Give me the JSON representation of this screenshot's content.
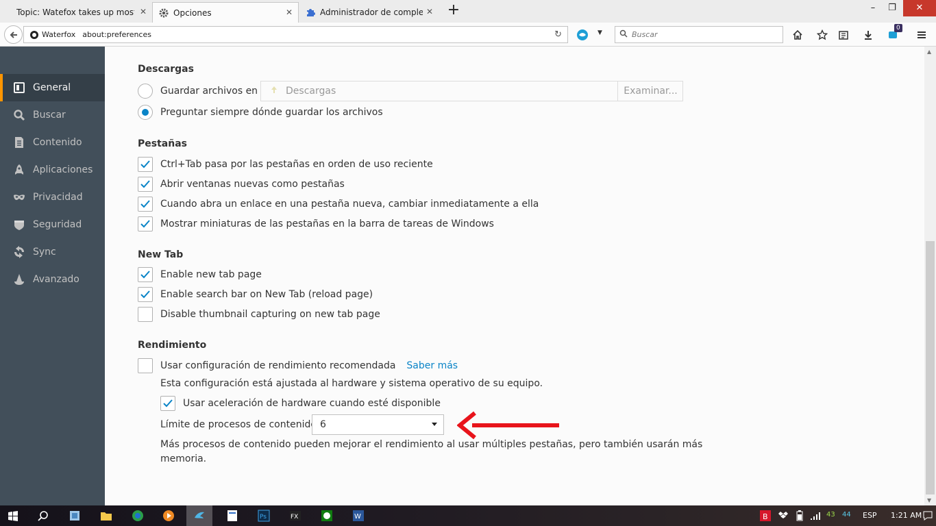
{
  "tabs": [
    {
      "title": "Topic: Watefox takes up most of",
      "icon": "page-icon",
      "state": "inactive"
    },
    {
      "title": "Opciones",
      "icon": "gear-icon",
      "state": "active"
    },
    {
      "title": "Administrador de compleme",
      "icon": "puzzle-icon",
      "state": "inactive"
    }
  ],
  "window_controls": {
    "minimize": "–",
    "restore": "❐",
    "close": "✕"
  },
  "navbar": {
    "identity_label": "Waterfox",
    "url": "about:preferences",
    "search_placeholder": "Buscar",
    "notification_count": "0"
  },
  "sidebar": {
    "items": [
      {
        "label": "General",
        "icon": "general-icon",
        "selected": true
      },
      {
        "label": "Buscar",
        "icon": "search-icon",
        "selected": false
      },
      {
        "label": "Contenido",
        "icon": "content-icon",
        "selected": false
      },
      {
        "label": "Aplicaciones",
        "icon": "applications-icon",
        "selected": false
      },
      {
        "label": "Privacidad",
        "icon": "privacy-mask-icon",
        "selected": false
      },
      {
        "label": "Seguridad",
        "icon": "security-icon",
        "selected": false
      },
      {
        "label": "Sync",
        "icon": "sync-icon",
        "selected": false
      },
      {
        "label": "Avanzado",
        "icon": "advanced-wizard-icon",
        "selected": false
      }
    ]
  },
  "downloads": {
    "title": "Descargas",
    "save_files_label": "Guardar archivos en",
    "folder_value": "Descargas",
    "browse_label": "Examinar...",
    "always_ask_label": "Preguntar siempre dónde guardar los archivos",
    "selected_option": "always_ask"
  },
  "tabs_section": {
    "title": "Pestañas",
    "options": [
      {
        "label": "Ctrl+Tab pasa por las pestañas en orden de uso reciente",
        "checked": true
      },
      {
        "label": "Abrir ventanas nuevas como pestañas",
        "checked": true
      },
      {
        "label": "Cuando abra un enlace en una pestaña nueva, cambiar inmediatamente a ella",
        "checked": true
      },
      {
        "label": "Mostrar miniaturas de las pestañas en la barra de tareas de Windows",
        "checked": true
      }
    ]
  },
  "newtab_section": {
    "title": "New Tab",
    "options": [
      {
        "label": "Enable new tab page",
        "checked": true
      },
      {
        "label": "Enable search bar on New Tab (reload page)",
        "checked": true
      },
      {
        "label": "Disable thumbnail capturing on new tab page",
        "checked": false
      }
    ]
  },
  "performance": {
    "title": "Rendimiento",
    "recommended_label": "Usar configuración de rendimiento recomendada",
    "recommended_checked": false,
    "learn_more": "Saber más",
    "recommended_desc": "Esta configuración está ajustada al hardware y sistema operativo de su equipo.",
    "hw_accel_label": "Usar aceleración de hardware cuando esté disponible",
    "hw_accel_checked": true,
    "process_limit_label": "Límite de procesos de contenido",
    "process_limit_value": "6",
    "process_desc_line1": "Más procesos de contenido pueden mejorar el rendimiento al usar múltiples pestañas, pero también usarán más",
    "process_desc_line2": "memoria."
  },
  "annotation": {
    "color": "#e8141b"
  },
  "taskbar": {
    "clock": "1:21 AM",
    "language": "ESP",
    "tray_num_1": "43",
    "tray_num_2": "44"
  }
}
